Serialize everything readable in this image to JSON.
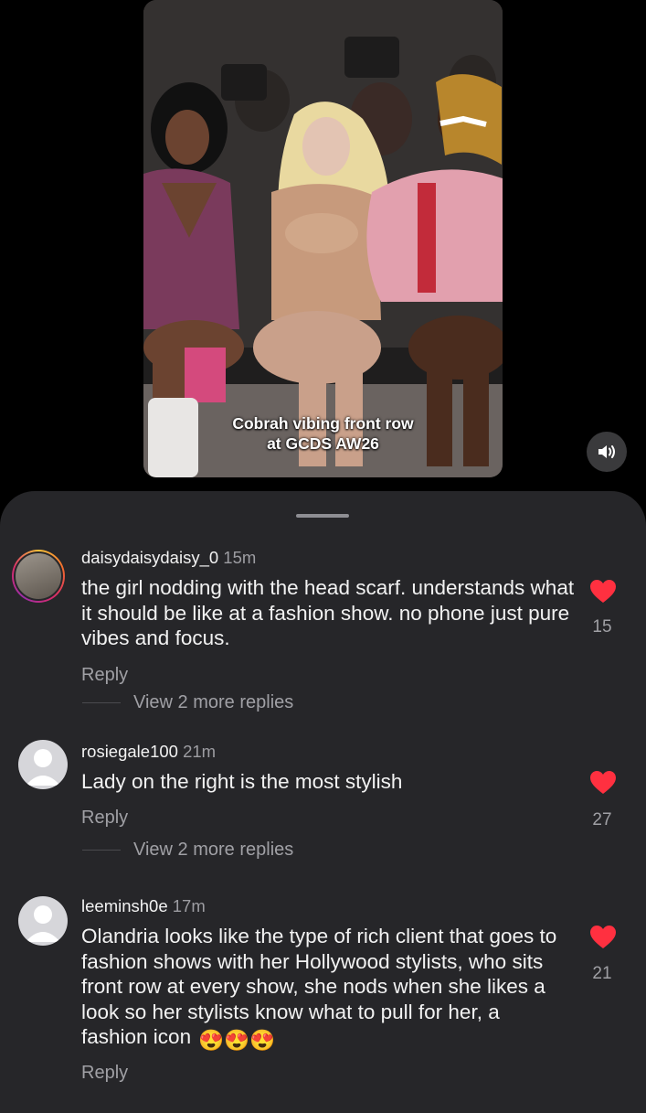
{
  "video": {
    "caption_line1": "Cobrah vibing front row",
    "caption_line2": "at GCDS AW26"
  },
  "controls": {
    "mute_icon": "speaker-icon"
  },
  "colors": {
    "like_red": "#ff3040",
    "sheet_bg": "#262629"
  },
  "comments": [
    {
      "username": "daisydaisydaisy_0",
      "time": "15m",
      "text": "the girl nodding with the head scarf. understands what it should be like at a fashion show. no phone just pure vibes and focus.",
      "reply_label": "Reply",
      "view_more": "View 2 more replies",
      "likes": "15"
    },
    {
      "username": "rosiegale100",
      "time": "21m",
      "text": "Lady on the right is the most stylish",
      "reply_label": "Reply",
      "view_more": "View 2 more replies",
      "likes": "27"
    },
    {
      "username": "leeminsh0e",
      "time": "17m",
      "text": "Olandria looks like the type of rich client that goes to fashion shows with her Hollywood stylists, who sits front row at every show, she nods when she likes a look so her stylists know what to pull for her,  a fashion icon",
      "emoji": "😍😍😍",
      "reply_label": "Reply",
      "likes": "21"
    }
  ]
}
